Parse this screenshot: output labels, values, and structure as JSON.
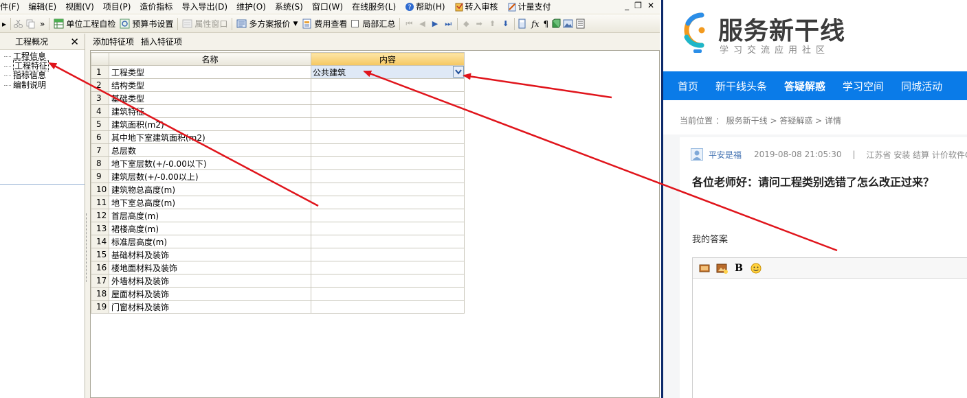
{
  "menubar": {
    "items": [
      "件(F)",
      "编辑(E)",
      "视图(V)",
      "项目(P)",
      "造价指标",
      "导入导出(D)",
      "维护(O)",
      "系统(S)",
      "窗口(W)",
      "在线服务(L)",
      "帮助(H)",
      "转入审核",
      "计量支付"
    ],
    "window_controls": [
      "_",
      "❐",
      "✕"
    ]
  },
  "toolbar": {
    "unit_check": "单位工程自检",
    "budget_settings": "预算书设置",
    "property_window": "属性窗口",
    "multi_plan_quote": "多方案报价",
    "cost_view": "费用查看",
    "partial_summary": "局部汇总"
  },
  "panel": {
    "title": "工程概况",
    "close": "✕",
    "tree": [
      "工程信息",
      "工程特征",
      "指标信息",
      "编制说明"
    ]
  },
  "subbar": {
    "add_feature": "添加特征项",
    "insert_feature": "插入特征项"
  },
  "grid": {
    "columns": [
      "名称",
      "内容"
    ],
    "rows": [
      {
        "num": "1",
        "name": "工程类型",
        "content": "公共建筑"
      },
      {
        "num": "2",
        "name": "结构类型",
        "content": ""
      },
      {
        "num": "3",
        "name": "基础类型",
        "content": ""
      },
      {
        "num": "4",
        "name": "建筑特征",
        "content": ""
      },
      {
        "num": "5",
        "name": "建筑面积(m2)",
        "content": ""
      },
      {
        "num": "6",
        "name": "其中地下室建筑面积(m2)",
        "content": ""
      },
      {
        "num": "7",
        "name": "总层数",
        "content": ""
      },
      {
        "num": "8",
        "name": "地下室层数(+/-0.00以下)",
        "content": ""
      },
      {
        "num": "9",
        "name": "建筑层数(+/-0.00以上)",
        "content": ""
      },
      {
        "num": "10",
        "name": "建筑物总高度(m)",
        "content": ""
      },
      {
        "num": "11",
        "name": "地下室总高度(m)",
        "content": ""
      },
      {
        "num": "12",
        "name": "首层高度(m)",
        "content": ""
      },
      {
        "num": "13",
        "name": "裙楼高度(m)",
        "content": ""
      },
      {
        "num": "14",
        "name": "标准层高度(m)",
        "content": ""
      },
      {
        "num": "15",
        "name": "基础材料及装饰",
        "content": ""
      },
      {
        "num": "16",
        "name": "楼地面材料及装饰",
        "content": ""
      },
      {
        "num": "17",
        "name": "外墙材料及装饰",
        "content": ""
      },
      {
        "num": "18",
        "name": "屋面材料及装饰",
        "content": ""
      },
      {
        "num": "19",
        "name": "门窗材料及装饰",
        "content": ""
      }
    ]
  },
  "site": {
    "logo_title": "服务新干线",
    "logo_subtitle": "学习交流应用社区",
    "nav": [
      "首页",
      "新干线头条",
      "答疑解惑",
      "学习空间",
      "同城活动"
    ],
    "nav_active": "答疑解惑",
    "breadcrumb": "当前位置 ： 服务新干线 > 答疑解惑 > 详情",
    "post": {
      "user": "平安是福",
      "datetime": "2019-08-08 21:05:30",
      "separator": "|",
      "tags": "江苏省  安装 结算 计价软件G",
      "title": "各位老师好：请问工程类别选错了怎么改正过来？"
    },
    "answer_label": "我的答案",
    "editor_bold": "B"
  },
  "colors": {
    "nav_blue": "#0a7be8",
    "arrow_red": "#e0141b",
    "header_active": "#f5c760"
  }
}
